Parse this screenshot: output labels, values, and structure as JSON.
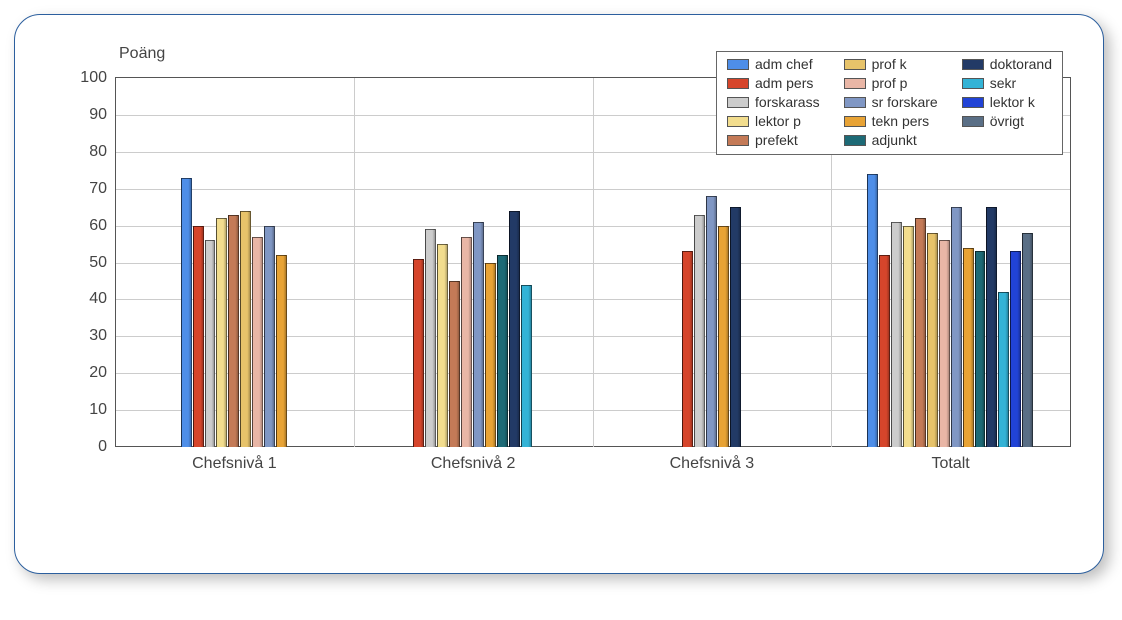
{
  "chart_data": {
    "type": "bar",
    "title": "",
    "xlabel": "",
    "ylabel": "Poäng",
    "ylim": [
      0,
      100
    ],
    "yticks": [
      0,
      10,
      20,
      30,
      40,
      50,
      60,
      70,
      80,
      90,
      100
    ],
    "categories": [
      "Chefsnivå 1",
      "Chefsnivå 2",
      "Chefsnivå 3",
      "Totalt"
    ],
    "series": [
      {
        "name": "adm chef",
        "color": "#4e8ee8",
        "values": [
          73,
          null,
          null,
          74
        ]
      },
      {
        "name": "adm pers",
        "color": "#d6452b",
        "values": [
          60,
          51,
          53,
          52
        ]
      },
      {
        "name": "forskarass",
        "color": "#cccccc",
        "values": [
          56,
          59,
          63,
          61
        ]
      },
      {
        "name": "lektor p",
        "color": "#f2dd8e",
        "values": [
          62,
          55,
          null,
          60
        ]
      },
      {
        "name": "prefekt",
        "color": "#c47a57",
        "values": [
          63,
          45,
          null,
          62
        ]
      },
      {
        "name": "prof k",
        "color": "#e7c36a",
        "values": [
          64,
          null,
          null,
          58
        ]
      },
      {
        "name": "prof p",
        "color": "#e9b6a6",
        "values": [
          57,
          57,
          null,
          56
        ]
      },
      {
        "name": "sr forskare",
        "color": "#8097c4",
        "values": [
          60,
          61,
          68,
          65
        ]
      },
      {
        "name": "tekn pers",
        "color": "#e8a335",
        "values": [
          52,
          50,
          60,
          54
        ]
      },
      {
        "name": "adjunkt",
        "color": "#1d6a76",
        "values": [
          null,
          52,
          null,
          53
        ]
      },
      {
        "name": "doktorand",
        "color": "#223a66",
        "values": [
          null,
          64,
          65,
          65
        ]
      },
      {
        "name": "sekr",
        "color": "#33b3d6",
        "values": [
          null,
          44,
          null,
          42
        ]
      },
      {
        "name": "lektor k",
        "color": "#2143d6",
        "values": [
          null,
          null,
          null,
          53
        ]
      },
      {
        "name": "övrigt",
        "color": "#5a6f86",
        "values": [
          null,
          null,
          null,
          58
        ]
      }
    ],
    "legend_position": "top-right",
    "grid": true
  }
}
